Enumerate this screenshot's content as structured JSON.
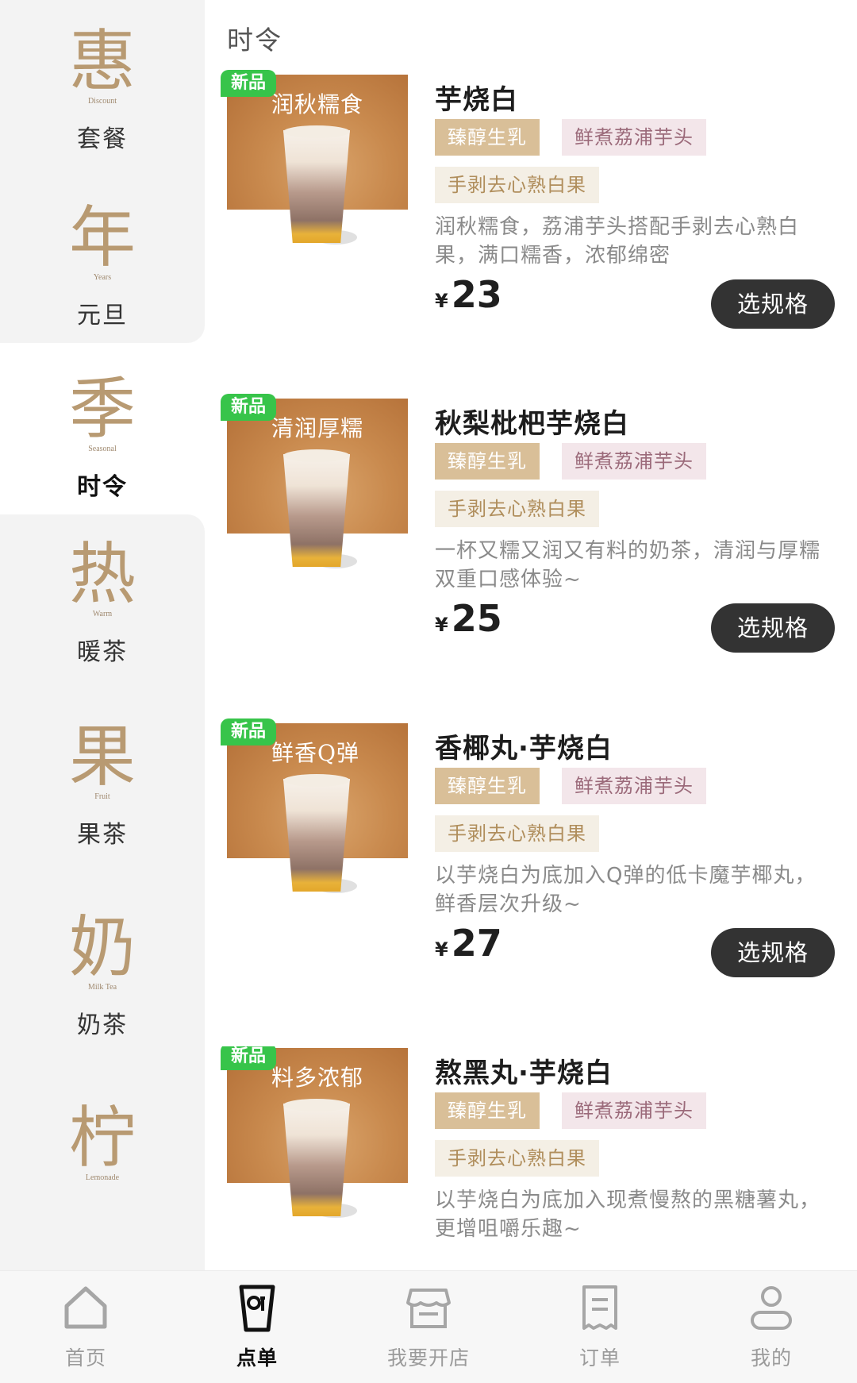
{
  "sidebar": {
    "categories": [
      {
        "big": "惠",
        "en": "Discount",
        "label": "套餐"
      },
      {
        "big": "年",
        "en": "Years",
        "label": "元旦"
      },
      {
        "big": "季",
        "en": "Seasonal",
        "label": "时令"
      },
      {
        "big": "热",
        "en": "Warm",
        "label": "暖茶"
      },
      {
        "big": "果",
        "en": "Fruit",
        "label": "果茶"
      },
      {
        "big": "奶",
        "en": "Milk Tea",
        "label": "奶茶"
      },
      {
        "big": "柠",
        "en": "Lemonade",
        "label": ""
      }
    ],
    "active_index": 2
  },
  "main": {
    "section_title": "时令",
    "products": [
      {
        "badge": "新品",
        "image_text": "润秋糯食",
        "name": "芋烧白",
        "tags": [
          "臻醇生乳",
          "鲜煮荔浦芋头",
          "手剥去心熟白果"
        ],
        "desc": "润秋糯食，荔浦芋头搭配手剥去心熟白果，满口糯香，浓郁绵密",
        "currency": "¥",
        "price": "23",
        "button": "选规格"
      },
      {
        "badge": "新品",
        "image_text": "清润厚糯",
        "name": "秋梨枇杷芋烧白",
        "tags": [
          "臻醇生乳",
          "鲜煮荔浦芋头",
          "手剥去心熟白果"
        ],
        "desc": "一杯又糯又润又有料的奶茶，清润与厚糯双重口感体验~",
        "currency": "¥",
        "price": "25",
        "button": "选规格"
      },
      {
        "badge": "新品",
        "image_text": "鲜香Q弹",
        "name": "香椰丸·芋烧白",
        "tags": [
          "臻醇生乳",
          "鲜煮荔浦芋头",
          "手剥去心熟白果"
        ],
        "desc": "以芋烧白为底加入Q弹的低卡魔芋椰丸，鲜香层次升级~",
        "currency": "¥",
        "price": "27",
        "button": "选规格"
      },
      {
        "badge": "新品",
        "image_text": "料多浓郁",
        "name": "熬黑丸·芋烧白",
        "tags": [
          "臻醇生乳",
          "鲜煮荔浦芋头",
          "手剥去心熟白果"
        ],
        "desc": "以芋烧白为底加入现煮慢熬的黑糖薯丸，更增咀嚼乐趣~",
        "currency": "¥",
        "price": "",
        "button": ""
      }
    ]
  },
  "tabbar": {
    "tabs": [
      {
        "label": "首页",
        "icon": "home-icon"
      },
      {
        "label": "点单",
        "icon": "cup-icon"
      },
      {
        "label": "我要开店",
        "icon": "store-icon"
      },
      {
        "label": "订单",
        "icon": "receipt-icon"
      },
      {
        "label": "我的",
        "icon": "user-icon"
      }
    ],
    "active_index": 1
  },
  "colors": {
    "accent_gold": "#b89a72",
    "badge_green": "#37c44a",
    "button_dark": "#333333",
    "tag_gold_bg": "#d9bf98",
    "tag_pink_bg": "#f3e6ea",
    "tag_cream_bg": "#f4efe5"
  }
}
